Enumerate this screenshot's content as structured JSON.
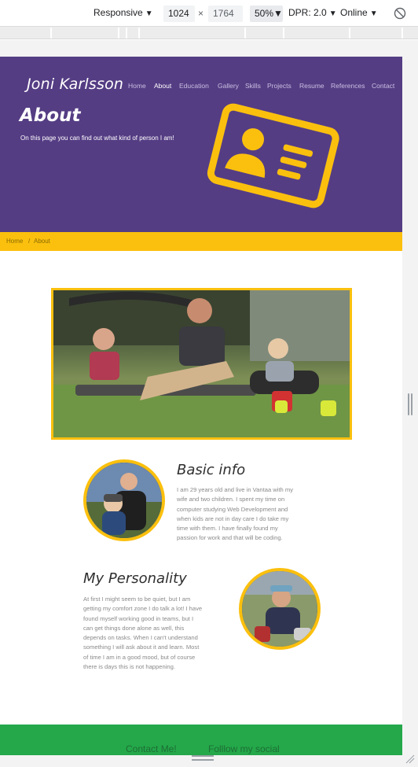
{
  "devtools": {
    "device": "Responsive",
    "width": "1024",
    "times": "×",
    "height": "1764",
    "zoom": "50%",
    "dpr": "DPR: 2.0",
    "network": "Online",
    "rotate_icon": "rotate-icon"
  },
  "site": {
    "brand": "Joni Karlsson",
    "nav": [
      "Home",
      "About",
      "Education",
      "Gallery",
      "Skills",
      "Projects",
      "Resume",
      "References",
      "Contact"
    ],
    "active_nav": "About",
    "hero_title": "About",
    "hero_subtitle": "On this page you can find out what kind of person I am!",
    "hero_icon": "id-card-icon",
    "breadcrumb": {
      "home": "Home",
      "separator": "/",
      "current": "About"
    },
    "basic_info": {
      "title": "Basic info",
      "lines": [
        "I am 29 years old and live in Vantaa with my",
        "wife and two children. I spent my time on",
        "computer studying Web Development and",
        "when kids are not in day care I do take my",
        "time with them. I have finally found my",
        "passion for work and that will be coding."
      ]
    },
    "personality": {
      "title": "My Personality",
      "lines": [
        "At first I might seem to be quiet, but I am",
        "getting my comfort zone I do talk a lot! I have",
        "found myself working good in teams, but I",
        "can get things done alone as well, this",
        "depends on tasks. When I can't understand",
        "something I will ask about it and learn. Most",
        "of time I am in a good mood, but of course",
        "there is days this is not happening."
      ]
    },
    "footer": {
      "contact": "Contact Me!",
      "social": "Folllow my social"
    },
    "colors": {
      "purple": "#553d84",
      "yellow": "#fbc00e",
      "green": "#24a84a"
    }
  }
}
